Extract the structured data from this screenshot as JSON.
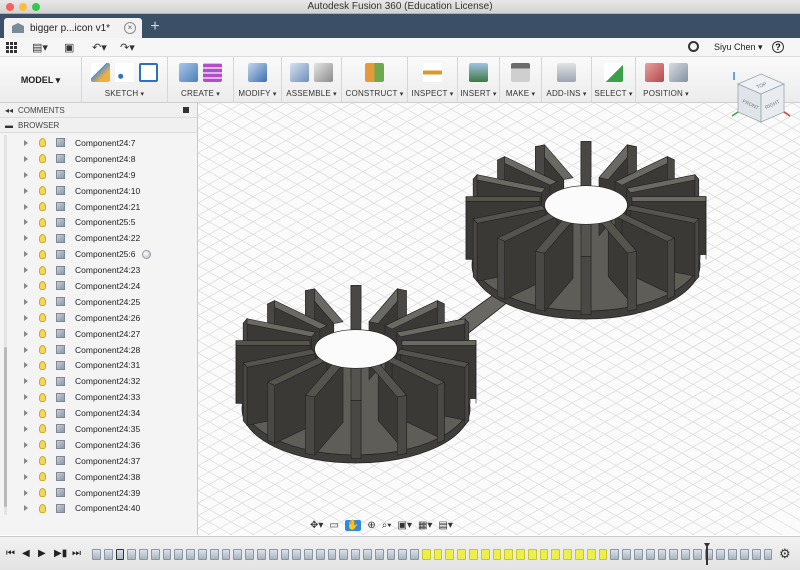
{
  "window": {
    "title": "Autodesk Fusion 360 (Education License)"
  },
  "tab": {
    "label": "bigger p...icon v1*",
    "close": "×",
    "new": "+"
  },
  "qat": {
    "user": "Siyu Chen ▾",
    "help": "?"
  },
  "ribbon": {
    "model": "MODEL ▾",
    "groups": [
      "SKETCH",
      "CREATE",
      "MODIFY",
      "ASSEMBLE",
      "CONSTRUCT",
      "INSPECT",
      "INSERT",
      "MAKE",
      "ADD-INS",
      "SELECT",
      "POSITION"
    ]
  },
  "panel": {
    "comments": "COMMENTS",
    "browser": "BROWSER",
    "items": [
      "Component24:7",
      "Component24:8",
      "Component24:9",
      "Component24:10",
      "Component24:21",
      "Component25:5",
      "Component24:22",
      "Component25:6",
      "Component24:23",
      "Component24:24",
      "Component24:25",
      "Component24:26",
      "Component24:27",
      "Component24:28",
      "Component24:31",
      "Component24:32",
      "Component24:33",
      "Component24:34",
      "Component24:35",
      "Component24:36",
      "Component24:37",
      "Component24:38",
      "Component24:39",
      "Component24:40"
    ]
  },
  "viewcube": {
    "top": "TOP",
    "front": "FRONT",
    "right": "RIGHT"
  },
  "colors": {
    "tabbar": "#3b4f66",
    "model": "#5c5a55",
    "highlight": "#eef04a",
    "accent": "#2f8be0"
  }
}
